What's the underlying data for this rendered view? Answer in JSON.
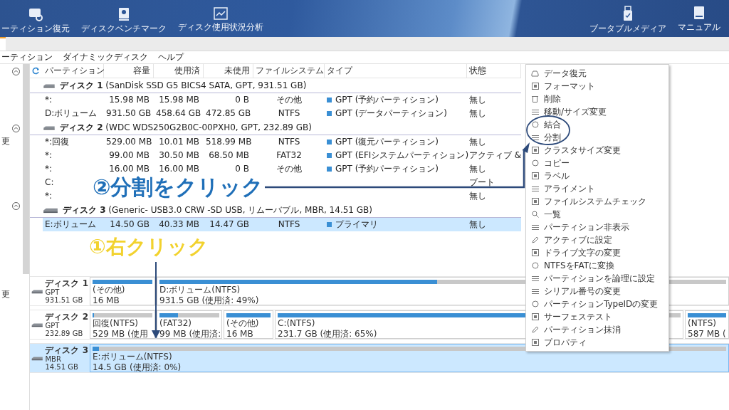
{
  "toolbar": {
    "tools": [
      {
        "label": "ーティション復元"
      },
      {
        "label": "ディスクベンチマーク"
      },
      {
        "label": "ディスク使用状況分析"
      }
    ],
    "right_tools": [
      {
        "label": "ブータブルメディア"
      },
      {
        "label": "マニュアル"
      }
    ]
  },
  "menu_bar": [
    "ーティション",
    "ダイナミックディスク",
    "ヘルプ"
  ],
  "sidebar": {
    "sections": [
      {
        "expanded": true
      },
      {
        "expanded": true,
        "text": "更"
      },
      {
        "expanded": true,
        "text": "更"
      }
    ]
  },
  "table": {
    "columns": [
      "パーティション",
      "容量",
      "使用済",
      "未使用",
      "ファイルシステム",
      "タイプ",
      "状態"
    ],
    "disks": [
      {
        "name": "ディスク 1",
        "detail": "(SanDisk SSD G5 BICS4 SATA, GPT, 931.51 GB)",
        "rows": [
          {
            "selected": false,
            "cells": [
              "*:",
              "15.98 MB",
              "15.98 MB",
              "0 B",
              "その他",
              "GPT (予約パーティション)",
              "無し"
            ]
          },
          {
            "selected": false,
            "cells": [
              "D:ボリューム",
              "931.50 GB",
              "458.64 GB",
              "472.85 GB",
              "NTFS",
              "GPT (データパーティション)",
              "無し"
            ]
          }
        ]
      },
      {
        "name": "ディスク 2",
        "detail": "(WDC WDS250G2B0C-00PXH0, GPT, 232.89 GB)",
        "rows": [
          {
            "selected": false,
            "cells": [
              "*:回復",
              "529.00 MB",
              "10.01 MB",
              "518.99 MB",
              "NTFS",
              "GPT (復元パーティション)",
              "無し"
            ]
          },
          {
            "selected": false,
            "cells": [
              "*:",
              "99.00 MB",
              "30.50 MB",
              "68.50 MB",
              "FAT32",
              "GPT (EFIシステムパーティション)",
              "アクティブ &"
            ]
          },
          {
            "selected": false,
            "cells": [
              "*:",
              "16.00 MB",
              "16.00 MB",
              "0 B",
              "その他",
              "GPT (予約パーティション)",
              "無し"
            ]
          },
          {
            "selected": false,
            "cells": [
              "C:",
              null,
              null,
              null,
              null,
              null,
              "ブート"
            ]
          },
          {
            "selected": false,
            "cells": [
              "*:",
              null,
              null,
              null,
              null,
              null,
              "無し"
            ]
          }
        ]
      },
      {
        "name": "ディスク 3",
        "detail": "(Generic- USB3.0 CRW -SD USB, リムーバブル, MBR, 14.51 GB)",
        "rows": [
          {
            "selected": true,
            "cells": [
              "E:ボリューム",
              "14.50 GB",
              "40.33 MB",
              "14.47 GB",
              "NTFS",
              "プライマリ",
              "無し"
            ]
          }
        ]
      }
    ]
  },
  "disk_map": [
    {
      "name": "ディスク 1",
      "style": "GPT",
      "size": "931.51 GB",
      "selected": false,
      "partitions": [
        {
          "kind": "narrow",
          "label": "(その他)",
          "size": "16 MB",
          "level": 1,
          "selected": false
        },
        {
          "kind": "wide",
          "label": "D:ボリューム(NTFS)",
          "size": "931.5 GB (使用済: 49%)",
          "level": 0.49,
          "selected": false
        }
      ]
    },
    {
      "name": "ディスク 2",
      "style": "GPT",
      "size": "232.89 GB",
      "selected": false,
      "partitions": [
        {
          "kind": "narrow",
          "label": "回復(NTFS)",
          "size": "529 MB (使用",
          "level": 0.02,
          "selected": false
        },
        {
          "kind": "narrow",
          "label": "(FAT32)",
          "size": "99 MB (使用済:",
          "level": 0.31,
          "selected": false
        },
        {
          "kind": "narrow",
          "label": "(その他)",
          "size": "16 MB",
          "level": 1,
          "selected": false
        },
        {
          "kind": "wide",
          "label": "C:(NTFS)",
          "size": "231.7 GB (使用済: 65%)",
          "level": 0.65,
          "selected": false
        },
        {
          "kind": "edge",
          "label": "(NTFS)",
          "size": "587 MB (",
          "level": 1,
          "selected": false
        }
      ]
    },
    {
      "name": "ディスク 3",
      "style": "MBR",
      "size": "14.51 GB",
      "selected": true,
      "partitions": [
        {
          "kind": "wide",
          "label": "E:ボリューム(NTFS)",
          "size": "14.5 GB (使用済: 0%)",
          "level": 0.01,
          "selected": true
        }
      ]
    }
  ],
  "context_menu": {
    "items": [
      "データ復元",
      "フォーマット",
      "削除",
      "移動/サイズ変更",
      "結合",
      "分割",
      "クラスタサイズ変更",
      "コピー",
      "ラベル",
      "アライメント",
      "ファイルシステムチェック",
      "一覧",
      "パーティション非表示",
      "アクティブに設定",
      "ドライブ文字の変更",
      "NTFSをFATに変換",
      "パーティションを論理に設定",
      "シリアル番号の変更",
      "パーティションTypeIDの変更",
      "サーフェステスト",
      "パーティション抹消",
      "プロパティ"
    ]
  },
  "annotations": [
    {
      "text": "②分割をクリック",
      "kind": "step2",
      "color": "#1f6fb8"
    },
    {
      "text": "①右クリック",
      "kind": "step1",
      "color": "#f2d22e"
    }
  ]
}
